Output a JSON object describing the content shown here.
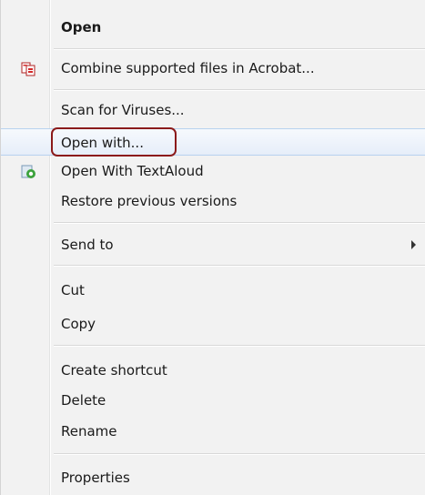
{
  "context_menu": {
    "items": [
      {
        "label": "Open",
        "icon": ""
      },
      {
        "label": "Combine supported files in Acrobat...",
        "icon": "acrobat-combine-icon"
      },
      {
        "label": "Scan for Viruses...",
        "icon": ""
      },
      {
        "label": "Open with...",
        "icon": ""
      },
      {
        "label": "Open With TextAloud",
        "icon": "textaloud-icon"
      },
      {
        "label": "Restore previous versions",
        "icon": ""
      },
      {
        "label": "Send to",
        "icon": "submenu-arrow-icon"
      },
      {
        "label": "Cut",
        "icon": ""
      },
      {
        "label": "Copy",
        "icon": ""
      },
      {
        "label": "Create shortcut",
        "icon": ""
      },
      {
        "label": "Delete",
        "icon": ""
      },
      {
        "label": "Rename",
        "icon": ""
      },
      {
        "label": "Properties",
        "icon": ""
      }
    ],
    "colors": {
      "highlight_outline": "#8b1a1a",
      "hover_border": "#b8d2ef",
      "menu_background": "#f2f2f2"
    }
  }
}
